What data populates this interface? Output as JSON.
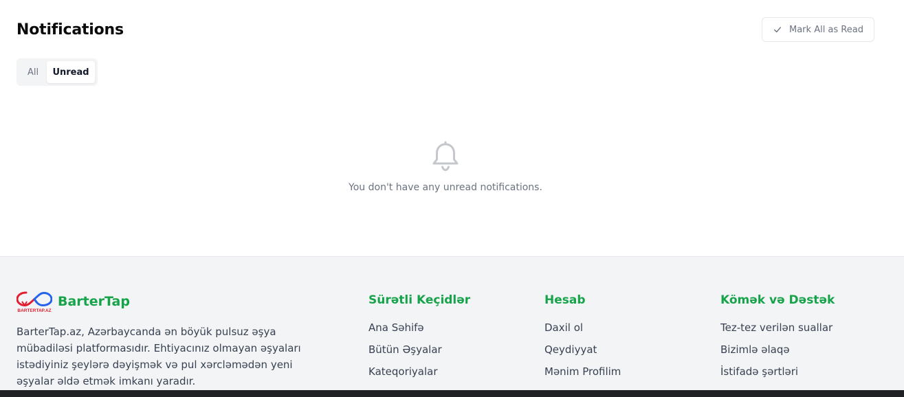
{
  "header": {
    "title": "Notifications",
    "mark_all_label": "Mark All as Read"
  },
  "tabs": [
    {
      "label": "All",
      "active": false
    },
    {
      "label": "Unread",
      "active": true
    }
  ],
  "empty_state": {
    "icon": "bell-icon",
    "message": "You don't have any unread notifications."
  },
  "footer": {
    "brand": {
      "name": "BarterTap",
      "logo_text": "BARTERTAP.AZ",
      "description": "BarterTap.az, Azərbaycanda ən böyük pulsuz əşya mübadiləsi platformasıdır. Ehtiyacınız olmayan əşyaları istədiyiniz şeylərə dəyişmək və pul xərcləmədən yeni əşyalar əldə etmək imkanı yaradır."
    },
    "columns": [
      {
        "title": "Sürətli Keçidlər",
        "links": [
          "Ana Səhifə",
          "Bütün Əşyalar",
          "Kateqoriyalar"
        ]
      },
      {
        "title": "Hesab",
        "links": [
          "Daxil ol",
          "Qeydiyyat",
          "Mənim Profilim"
        ]
      },
      {
        "title": "Kömək və Dəstək",
        "links": [
          "Tez-tez verilən suallar",
          "Bizimlə əlaqə",
          "İstifadə şərtləri"
        ]
      }
    ]
  },
  "colors": {
    "brand_green": "#16a34a",
    "muted_text": "#6b7280",
    "footer_bg": "#f3f4f6"
  }
}
